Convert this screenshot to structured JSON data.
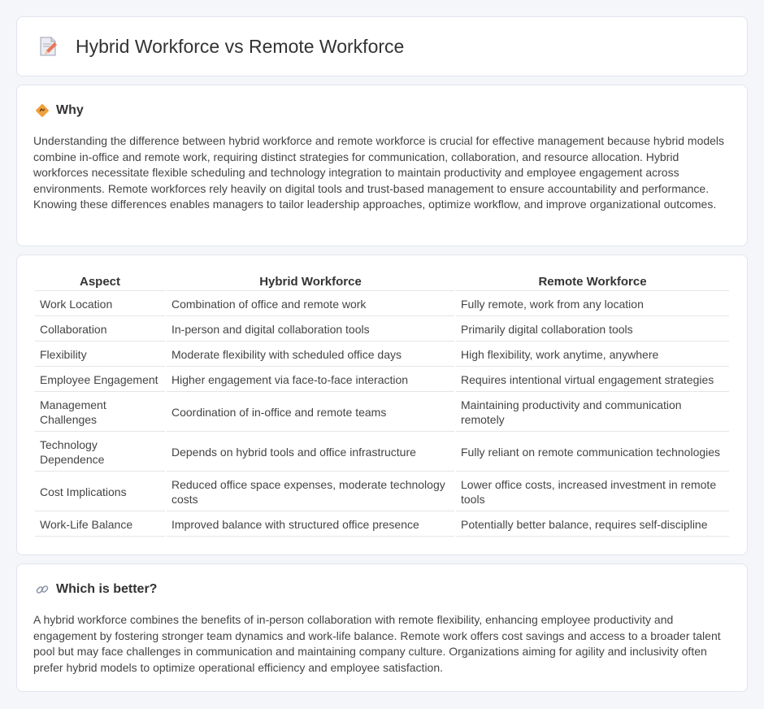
{
  "header": {
    "title": "Hybrid Workforce vs Remote Workforce",
    "icon": "document-pencil-icon"
  },
  "why": {
    "heading": "Why",
    "icon": "diamond-sign-icon",
    "text": "Understanding the difference between hybrid workforce and remote workforce is crucial for effective management because hybrid models combine in-office and remote work, requiring distinct strategies for communication, collaboration, and resource allocation. Hybrid workforces necessitate flexible scheduling and technology integration to maintain productivity and employee engagement across environments. Remote workforces rely heavily on digital tools and trust-based management to ensure accountability and performance. Knowing these differences enables managers to tailor leadership approaches, optimize workflow, and improve organizational outcomes."
  },
  "table": {
    "headers": [
      "Aspect",
      "Hybrid Workforce",
      "Remote Workforce"
    ],
    "rows": [
      [
        "Work Location",
        "Combination of office and remote work",
        "Fully remote, work from any location"
      ],
      [
        "Collaboration",
        "In-person and digital collaboration tools",
        "Primarily digital collaboration tools"
      ],
      [
        "Flexibility",
        "Moderate flexibility with scheduled office days",
        "High flexibility, work anytime, anywhere"
      ],
      [
        "Employee Engagement",
        "Higher engagement via face-to-face interaction",
        "Requires intentional virtual engagement strategies"
      ],
      [
        "Management Challenges",
        "Coordination of in-office and remote teams",
        "Maintaining productivity and communication remotely"
      ],
      [
        "Technology Dependence",
        "Depends on hybrid tools and office infrastructure",
        "Fully reliant on remote communication technologies"
      ],
      [
        "Cost Implications",
        "Reduced office space expenses, moderate technology costs",
        "Lower office costs, increased investment in remote tools"
      ],
      [
        "Work-Life Balance",
        "Improved balance with structured office presence",
        "Potentially better balance, requires self-discipline"
      ]
    ]
  },
  "better": {
    "heading": "Which is better?",
    "icon": "link-icon",
    "text": "A hybrid workforce combines the benefits of in-person collaboration with remote flexibility, enhancing employee productivity and engagement by fostering stronger team dynamics and work-life balance. Remote work offers cost savings and access to a broader talent pool but may face challenges in communication and maintaining company culture. Organizations aiming for agility and inclusivity often prefer hybrid models to optimize operational efficiency and employee satisfaction."
  },
  "colors": {
    "background": "#f4f6fa",
    "card": "#ffffff",
    "border": "#e1e5ec",
    "accent": "#f0a03c"
  }
}
